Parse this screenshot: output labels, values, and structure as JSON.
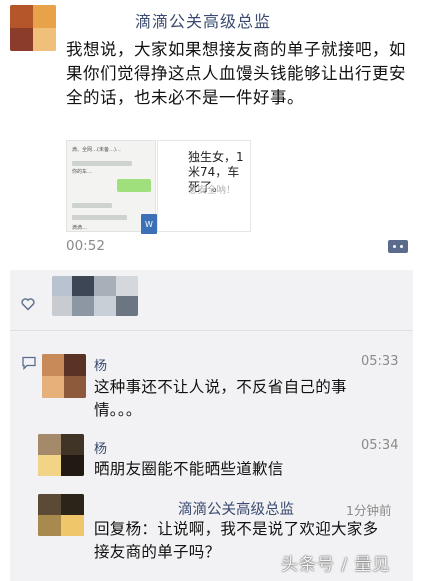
{
  "post": {
    "author": "滴滴公关高级总监",
    "text": "我想说，大家如果想接友商的单子就接吧，如果你们觉得挣这点人血馒头钱能够让出行更安全的话，也未必不是一件好事。",
    "time": "00:52",
    "attachment": {
      "chat_message": "独生女，1米74，车死了。",
      "chat_sub": "意安全呐！",
      "file_icon_letter": "W"
    }
  },
  "comments": [
    {
      "name": "杨",
      "time": "05:33",
      "text": "这种事还不让人说，不反省自己的事情。。。"
    },
    {
      "name": "杨",
      "time": "05:34",
      "text": "晒朋友圈能不能晒些道歉信"
    },
    {
      "name": "滴滴公关高级总监",
      "time": "1分钟前",
      "text": "回复杨：让说啊，我不是说了欢迎大家多接友商的单子吗？"
    }
  ],
  "watermark": "头条号 / 量见",
  "icons": {
    "like": "heart-icon",
    "comment": "comment-icon",
    "more": "more-dots-icon",
    "file": "word-doc-icon"
  },
  "colors": {
    "name_link": "#3a4a70",
    "comment_bg": "#f2f2f4",
    "time_gray": "#8a8a8a"
  }
}
